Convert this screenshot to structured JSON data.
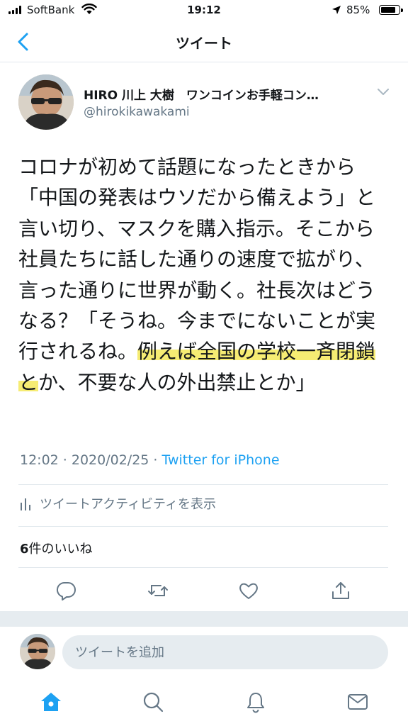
{
  "status_bar": {
    "carrier": "SoftBank",
    "time": "19:12",
    "battery": "85%",
    "battery_level": 0.85
  },
  "nav": {
    "title": "ツイート",
    "back_icon": "chevron-left-icon"
  },
  "tweet": {
    "author_name": "HIRO 川上 大樹　ワンコインお手軽コン…",
    "author_handle": "@hirokikawakami",
    "text_before": "コロナが初めて話題になったときから「中国の発表はウソだから備えよう」と言い切り、マスクを購入指示。そこから社員たちに話した通りの速度で拡がり、言った通りに世界が動く。社長次はどうなる？「そうね。今までにないことが実行されるね。",
    "text_highlight": "例えば全国の学校一斉閉鎖と",
    "text_after": "か、不要な人の外出禁止とか」",
    "timestamp": "12:02 · 2020/02/25 · ",
    "source": "Twitter for iPhone",
    "activity_label": "ツイートアクティビティを表示",
    "likes_count": "6",
    "likes_label": "件のいいね"
  },
  "actions": [
    "reply-icon",
    "retweet-icon",
    "like-icon",
    "share-icon"
  ],
  "reply": {
    "placeholder": "ツイートを追加"
  },
  "tab_bar": [
    "home-icon",
    "search-icon",
    "notifications-icon",
    "messages-icon"
  ],
  "colors": {
    "accent": "#1da1f2",
    "secondary_text": "#657786",
    "highlight": "#f6ec73",
    "divider": "#e1e8ed"
  }
}
